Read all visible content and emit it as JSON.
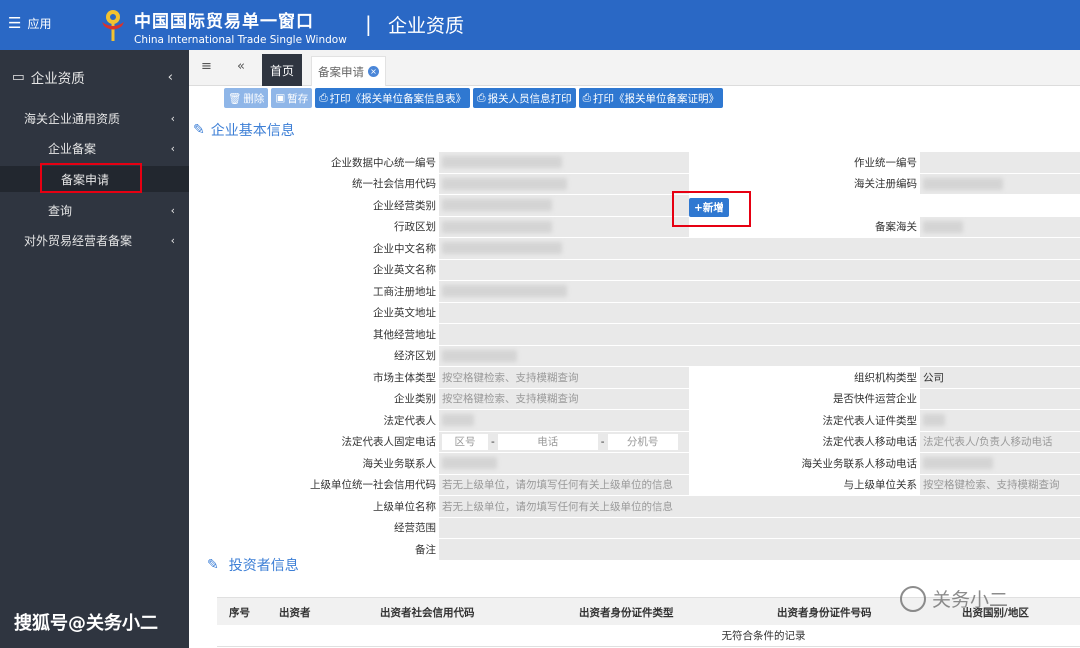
{
  "topbar": {
    "app_label": "应用",
    "brand_cn": "中国国际贸易单一窗口",
    "brand_en": "China International Trade Single Window",
    "module_title": "企业资质"
  },
  "sidebar": {
    "header": "企业资质",
    "items": [
      {
        "label": "海关企业通用资质"
      },
      {
        "label": "企业备案"
      },
      {
        "label": "备案申请"
      },
      {
        "label": "查询"
      },
      {
        "label": "对外贸易经营者备案"
      }
    ],
    "watermark": "搜狐号@关务小二"
  },
  "tabs": {
    "home": "首页",
    "apply": "备案申请"
  },
  "toolbar": {
    "delete": "删除",
    "save_temp": "暂存",
    "print_info": "打印《报关单位备案信息表》",
    "print_staff": "报关人员信息打印",
    "print_cert": "打印《报关单位备案证明》"
  },
  "section_basic": "企业基本信息",
  "section_investor": "投资者信息",
  "form": {
    "add_button": "新增",
    "labels": {
      "data_center_code": "企业数据中心统一编号",
      "operation_code": "作业统一编号",
      "credit_code": "统一社会信用代码",
      "customs_reg_code": "海关注册编码",
      "business_category": "企业经营类别",
      "admin_region": "行政区划",
      "customs_office": "备案海关",
      "cn_name": "企业中文名称",
      "en_name": "企业英文名称",
      "reg_address": "工商注册地址",
      "en_address": "企业英文地址",
      "other_address": "其他经营地址",
      "economic_zone": "经济区划",
      "market_type": "市场主体类型",
      "org_type": "组织机构类型",
      "enterprise_category": "企业类别",
      "express_operator": "是否快件运营企业",
      "legal_rep": "法定代表人",
      "legal_rep_id_type": "法定代表人证件类型",
      "legal_rep_phone": "法定代表人固定电话",
      "legal_rep_mobile": "法定代表人移动电话",
      "customs_contact": "海关业务联系人",
      "customs_contact_mobile": "海关业务联系人移动电话",
      "parent_credit_code": "上级单位统一社会信用代码",
      "parent_relation": "与上级单位关系",
      "parent_name": "上级单位名称",
      "business_scope": "经营范围",
      "remarks": "备注"
    },
    "values": {
      "market_type": "按空格键检索、支持模糊查询",
      "org_type": "公司",
      "enterprise_category": "按空格键检索、支持模糊查询",
      "phone_area": "区号",
      "phone_number": "电话",
      "phone_ext": "分机号",
      "dash": "-",
      "legal_rep_mobile": "法定代表人/负责人移动电话",
      "parent_credit_code": "若无上级单位，请勿填写任何有关上级单位的信息",
      "parent_relation": "按空格键检索、支持模糊查询",
      "parent_name": "若无上级单位，请勿填写任何有关上级单位的信息"
    }
  },
  "investor_table": {
    "columns": [
      "序号",
      "出资者",
      "出资者社会信用代码",
      "出资者身份证件类型",
      "出资者身份证件号码",
      "出资国别/地区"
    ],
    "empty": "无符合条件的记录"
  },
  "wechat_watermark": "关务小二"
}
